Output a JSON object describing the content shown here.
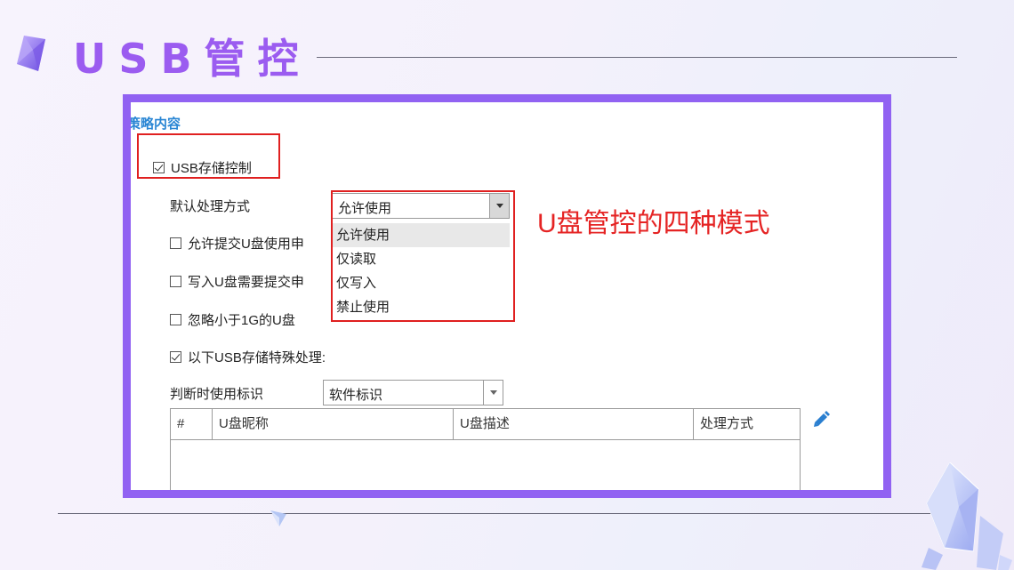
{
  "header": {
    "title": "USB管控"
  },
  "policy": {
    "section_title": "策略内容",
    "usb_storage_control": {
      "label": "USB存储控制",
      "checked": true
    },
    "default_mode": {
      "label": "默认处理方式",
      "value": "允许使用",
      "options": [
        "允许使用",
        "仅读取",
        "仅写入",
        "禁止使用"
      ],
      "highlighted": "允许使用"
    },
    "checkboxes": [
      {
        "label": "允许提交U盘使用申",
        "checked": false
      },
      {
        "label": "写入U盘需要提交申",
        "checked": false
      },
      {
        "label": "忽略小于1G的U盘",
        "checked": false
      }
    ],
    "special_handling": {
      "label": "以下USB存储特殊处理:",
      "checked": true
    },
    "identify_by": {
      "label": "判断时使用标识",
      "value": "软件标识"
    },
    "table": {
      "columns": [
        "#",
        "U盘昵称",
        "U盘描述",
        "处理方式"
      ],
      "rows": []
    }
  },
  "annotation": {
    "text": "U盘管控的四种模式",
    "color": "#e52424"
  },
  "colors": {
    "accent": "#9162f2",
    "title": "#9b5cf0",
    "highlight_red": "#e02020",
    "link_blue": "#2a86d4"
  },
  "icons": [
    "crystal-gem-icon",
    "checkbox-icon",
    "dropdown-arrow-icon",
    "edit-pencil-icon",
    "crystal-cluster-icon"
  ]
}
